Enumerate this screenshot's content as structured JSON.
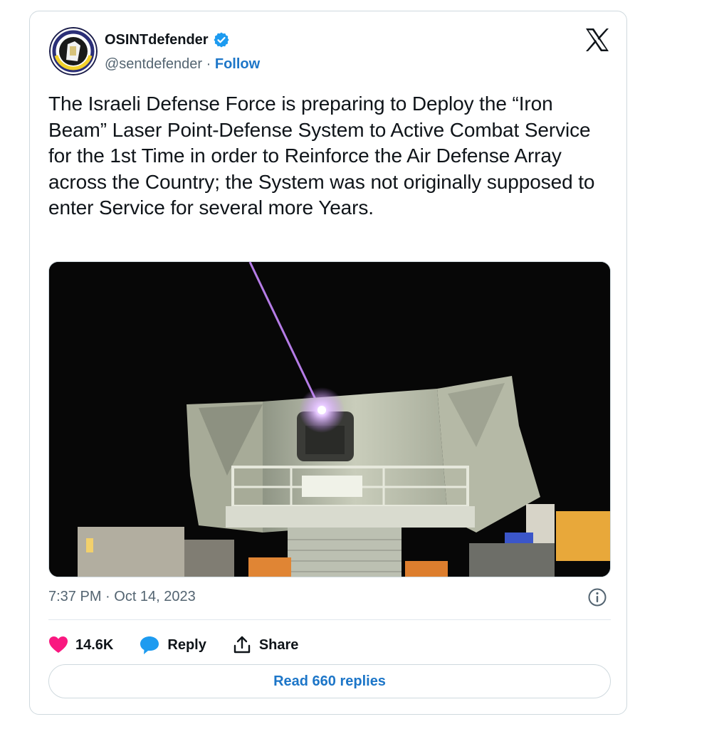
{
  "author": {
    "display_name": "OSINTdefender",
    "handle": "@sentdefender",
    "separator": "·",
    "follow_label": "Follow",
    "verified": true
  },
  "tweet": {
    "text": "The Israeli Defense Force is preparing to Deploy the “Iron Beam” Laser Point-Defense System to Active Combat Service for the 1st Time in order to Reinforce the Air Defense Array across the Country; the System was not originally supposed to enter Service for several more Years.",
    "timestamp": "7:37 PM · Oct 14, 2023"
  },
  "actions": {
    "like_count": "14.6K",
    "reply_label": "Reply",
    "share_label": "Share"
  },
  "read_replies_label": "Read 660 replies",
  "icons": {
    "logo": "x-logo-icon",
    "verified": "verified-badge-icon",
    "info": "info-icon",
    "like": "heart-icon",
    "reply": "speech-bubble-icon",
    "share": "share-upload-icon"
  },
  "colors": {
    "link": "#1d76c8",
    "verified": "#1d9bf0",
    "heart": "#f91880",
    "reply_bubble": "#1d9bf0",
    "laser": "#c889ff"
  }
}
